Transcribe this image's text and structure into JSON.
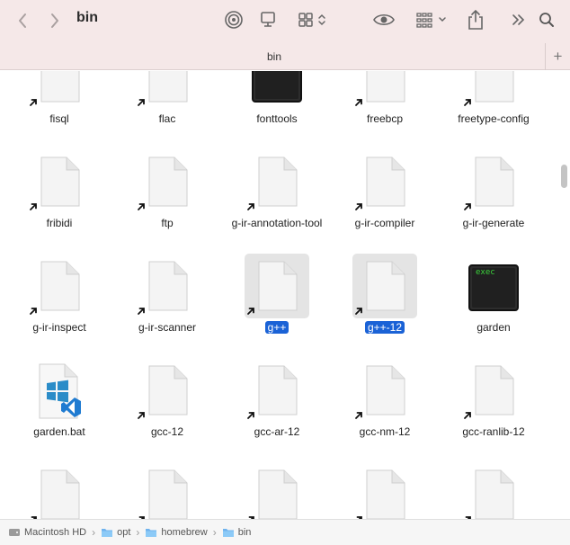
{
  "window": {
    "title": "bin"
  },
  "tab": {
    "label": "bin"
  },
  "toolbar": {
    "icons": [
      "back-icon",
      "forward-icon",
      "airdrop-icon",
      "desktop-icon",
      "view-grid-icon",
      "preview-icon",
      "group-icon",
      "share-icon",
      "more-icon",
      "search-icon"
    ]
  },
  "files": [
    {
      "name": "fisql",
      "kind": "doc",
      "alias": true
    },
    {
      "name": "flac",
      "kind": "doc",
      "alias": true
    },
    {
      "name": "fonttools",
      "kind": "exec-dark",
      "alias": false
    },
    {
      "name": "freebcp",
      "kind": "doc",
      "alias": true
    },
    {
      "name": "freetype-config",
      "kind": "doc",
      "alias": true
    },
    {
      "name": "fribidi",
      "kind": "doc",
      "alias": true
    },
    {
      "name": "ftp",
      "kind": "doc",
      "alias": true
    },
    {
      "name": "g-ir-annotation-tool",
      "kind": "doc",
      "alias": true
    },
    {
      "name": "g-ir-compiler",
      "kind": "doc",
      "alias": true
    },
    {
      "name": "g-ir-generate",
      "kind": "doc",
      "alias": true
    },
    {
      "name": "g-ir-inspect",
      "kind": "doc",
      "alias": true
    },
    {
      "name": "g-ir-scanner",
      "kind": "doc",
      "alias": true
    },
    {
      "name": "g++",
      "kind": "doc",
      "alias": true,
      "selected": true
    },
    {
      "name": "g++-12",
      "kind": "doc",
      "alias": true,
      "selected": true
    },
    {
      "name": "garden",
      "kind": "exec",
      "alias": false,
      "exec_label": "exec"
    },
    {
      "name": "garden.bat",
      "kind": "bat",
      "alias": false
    },
    {
      "name": "gcc-12",
      "kind": "doc",
      "alias": true
    },
    {
      "name": "gcc-ar-12",
      "kind": "doc",
      "alias": true
    },
    {
      "name": "gcc-nm-12",
      "kind": "doc",
      "alias": true
    },
    {
      "name": "gcc-ranlib-12",
      "kind": "doc",
      "alias": true
    },
    {
      "name": "",
      "kind": "doc",
      "alias": true
    },
    {
      "name": "",
      "kind": "doc",
      "alias": true
    },
    {
      "name": "",
      "kind": "doc",
      "alias": true
    },
    {
      "name": "",
      "kind": "doc",
      "alias": true
    },
    {
      "name": "",
      "kind": "doc",
      "alias": true
    }
  ],
  "pathbar": {
    "crumbs": [
      {
        "label": "Macintosh HD",
        "icon": "hard-drive-icon"
      },
      {
        "label": "opt",
        "icon": "folder-icon"
      },
      {
        "label": "homebrew",
        "icon": "folder-icon"
      },
      {
        "label": "bin",
        "icon": "folder-icon"
      }
    ]
  },
  "colors": {
    "toolbar_bg": "#f5e8e8",
    "selection": "#1a62d6",
    "exec_text": "#3bd23b"
  }
}
